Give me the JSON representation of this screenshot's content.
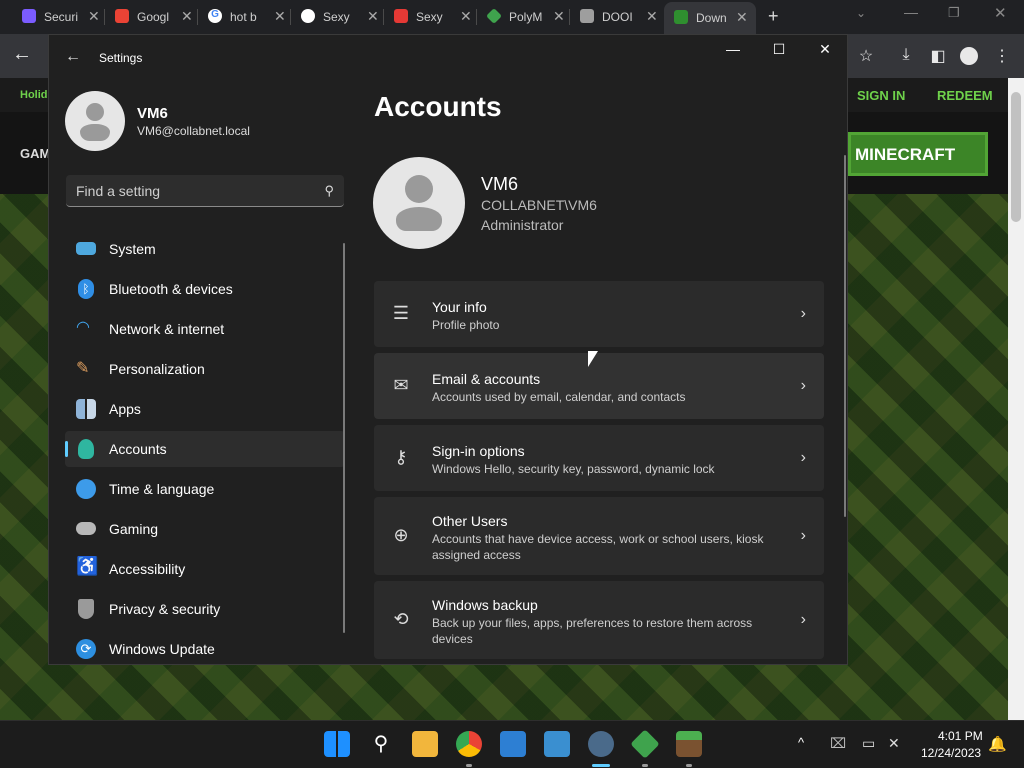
{
  "browser": {
    "tabs": [
      {
        "label": "Securi",
        "icon": "shield-icon",
        "color": "#7b5cff"
      },
      {
        "label": "Googl",
        "icon": "google-icon",
        "color": "#ea4335"
      },
      {
        "label": "hot b",
        "icon": "google-icon",
        "color": "#4285f4"
      },
      {
        "label": "Sexy",
        "icon": "site-icon",
        "color": "#222222"
      },
      {
        "label": "Sexy",
        "icon": "site-icon",
        "color": "#e53935"
      },
      {
        "label": "PolyM",
        "icon": "polymarket-icon",
        "color": "#3fa34d"
      },
      {
        "label": "DOOI",
        "icon": "document-icon",
        "color": "#9e9e9e"
      },
      {
        "label": "Down",
        "icon": "minecraft-icon",
        "color": "#2f8f2f"
      }
    ],
    "new_tab": "+"
  },
  "minecraft_page": {
    "promo": "Holid",
    "sign_in": "SIGN IN",
    "redeem": "REDEEM",
    "nav_left": "GAM",
    "cta": "MINECRAFT"
  },
  "settings": {
    "window_title": "Settings",
    "user": {
      "name": "VM6",
      "email": "VM6@collabnet.local"
    },
    "search_placeholder": "Find a setting",
    "nav": [
      {
        "label": "System",
        "icon": "system-icon",
        "color": "#4ea8de"
      },
      {
        "label": "Bluetooth & devices",
        "icon": "bluetooth-icon",
        "color": "#2f8ee5"
      },
      {
        "label": "Network & internet",
        "icon": "wifi-icon",
        "color": "#41a5ee"
      },
      {
        "label": "Personalization",
        "icon": "brush-icon",
        "color": "#e0a060"
      },
      {
        "label": "Apps",
        "icon": "apps-icon",
        "color": "#8fb4d8"
      },
      {
        "label": "Accounts",
        "icon": "person-icon",
        "color": "#2fb6a0"
      },
      {
        "label": "Time & language",
        "icon": "globe-clock-icon",
        "color": "#3d9be9"
      },
      {
        "label": "Gaming",
        "icon": "gamepad-icon",
        "color": "#b8b8b8"
      },
      {
        "label": "Accessibility",
        "icon": "accessibility-icon",
        "color": "#3aa0f0"
      },
      {
        "label": "Privacy & security",
        "icon": "shield-icon",
        "color": "#9a9a9a"
      },
      {
        "label": "Windows Update",
        "icon": "update-icon",
        "color": "#2d8fe0"
      }
    ],
    "selected_nav": "Accounts",
    "page_title": "Accounts",
    "account": {
      "name": "VM6",
      "domain": "COLLABNET\\VM6",
      "role": "Administrator"
    },
    "cards": [
      {
        "title": "Your info",
        "subtitle": "Profile photo",
        "icon": "person-card-icon"
      },
      {
        "title": "Email & accounts",
        "subtitle": "Accounts used by email, calendar, and contacts",
        "icon": "mail-icon"
      },
      {
        "title": "Sign-in options",
        "subtitle": "Windows Hello, security key, password, dynamic lock",
        "icon": "key-icon"
      },
      {
        "title": "Other Users",
        "subtitle": "Accounts that have device access, work or school users, kiosk assigned access",
        "icon": "add-person-icon"
      },
      {
        "title": "Windows backup",
        "subtitle": "Back up your files, apps, preferences to restore them across devices",
        "icon": "backup-icon"
      }
    ]
  },
  "taskbar": {
    "time": "4:01 PM",
    "date": "12/24/2023"
  }
}
